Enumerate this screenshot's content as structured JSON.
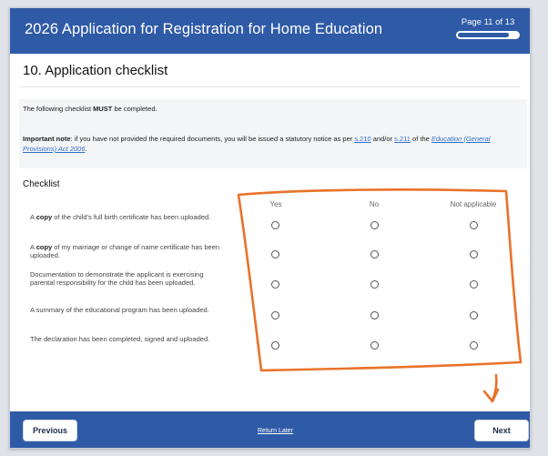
{
  "header": {
    "title": "2026 Application for Registration for Home Education",
    "page_indicator": "Page 11 of 13",
    "progress_fraction": 0.846
  },
  "section": {
    "title": "10. Application checklist"
  },
  "info": {
    "line1_prefix": "The following checklist ",
    "line1_bold": "MUST",
    "line1_suffix": " be completed.",
    "note_label": "Important note",
    "note_text": ": if you have not provided the required documents, you will be issued a statutory notice as per ",
    "link1": "s.210",
    "and_or": " and/or ",
    "link2": "s.211",
    "of_the": " of the ",
    "act_link": "Education (General Provisions) Act 2006",
    "end": "."
  },
  "checklist": {
    "title": "Checklist",
    "columns": [
      "Yes",
      "No",
      "Not applicable"
    ],
    "items": [
      {
        "prefix": "A ",
        "bold": "copy",
        "text": " of the child's full birth certificate has been uploaded."
      },
      {
        "prefix": "A ",
        "bold": "copy",
        "text": " of my marriage or change of name certificate has been uploaded."
      },
      {
        "prefix": "",
        "bold": "",
        "text": "Documentation to demonstrate the applicant is exercising parental responsibility for the child has been uploaded."
      },
      {
        "prefix": "",
        "bold": "",
        "text": "A summary of the educational program has been uploaded."
      },
      {
        "prefix": "",
        "bold": "",
        "text": "The declaration has been completed, signed and uploaded."
      }
    ]
  },
  "footer": {
    "previous_label": "Previous",
    "return_later_label": "Return Later",
    "next_label": "Next"
  },
  "colors": {
    "brand": "#2f5aa6",
    "annotation": "#e8732a",
    "link": "#2f6fc9"
  }
}
